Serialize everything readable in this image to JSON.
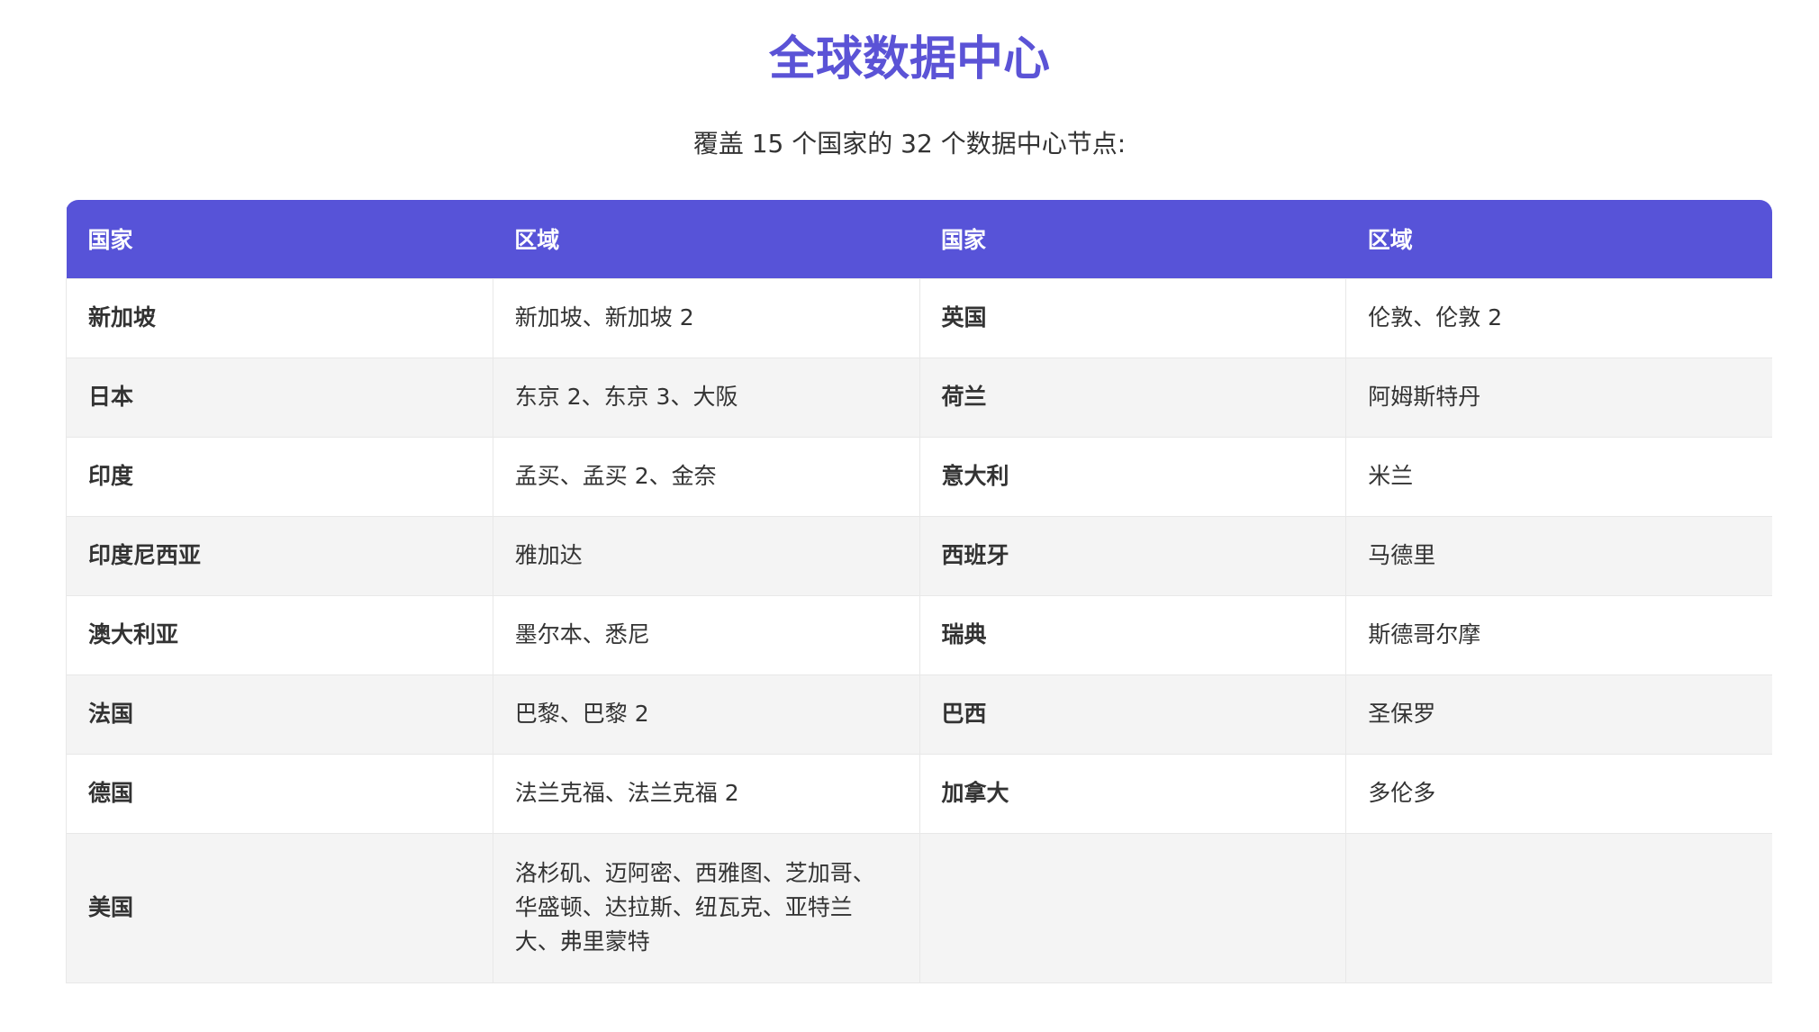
{
  "title": "全球数据中心",
  "subtitle": "覆盖 15 个国家的 32 个数据中心节点:",
  "table": {
    "headers": [
      "国家",
      "区域",
      "国家",
      "区域"
    ],
    "rows": [
      {
        "country1": "新加坡",
        "regions1": "新加坡、新加坡 2",
        "country2": "英国",
        "regions2": "伦敦、伦敦 2"
      },
      {
        "country1": "日本",
        "regions1": "东京 2、东京 3、大阪",
        "country2": "荷兰",
        "regions2": "阿姆斯特丹"
      },
      {
        "country1": "印度",
        "regions1": "孟买、孟买 2、金奈",
        "country2": "意大利",
        "regions2": "米兰"
      },
      {
        "country1": "印度尼西亚",
        "regions1": "雅加达",
        "country2": "西班牙",
        "regions2": "马德里"
      },
      {
        "country1": "澳大利亚",
        "regions1": "墨尔本、悉尼",
        "country2": "瑞典",
        "regions2": "斯德哥尔摩"
      },
      {
        "country1": "法国",
        "regions1": "巴黎、巴黎 2",
        "country2": "巴西",
        "regions2": "圣保罗"
      },
      {
        "country1": "德国",
        "regions1": "法兰克福、法兰克福 2",
        "country2": "加拿大",
        "regions2": "多伦多"
      },
      {
        "country1": "美国",
        "regions1": "洛杉矶、迈阿密、西雅图、芝加哥、华盛顿、达拉斯、纽瓦克、亚特兰大、弗里蒙特",
        "country2": "",
        "regions2": ""
      }
    ]
  }
}
